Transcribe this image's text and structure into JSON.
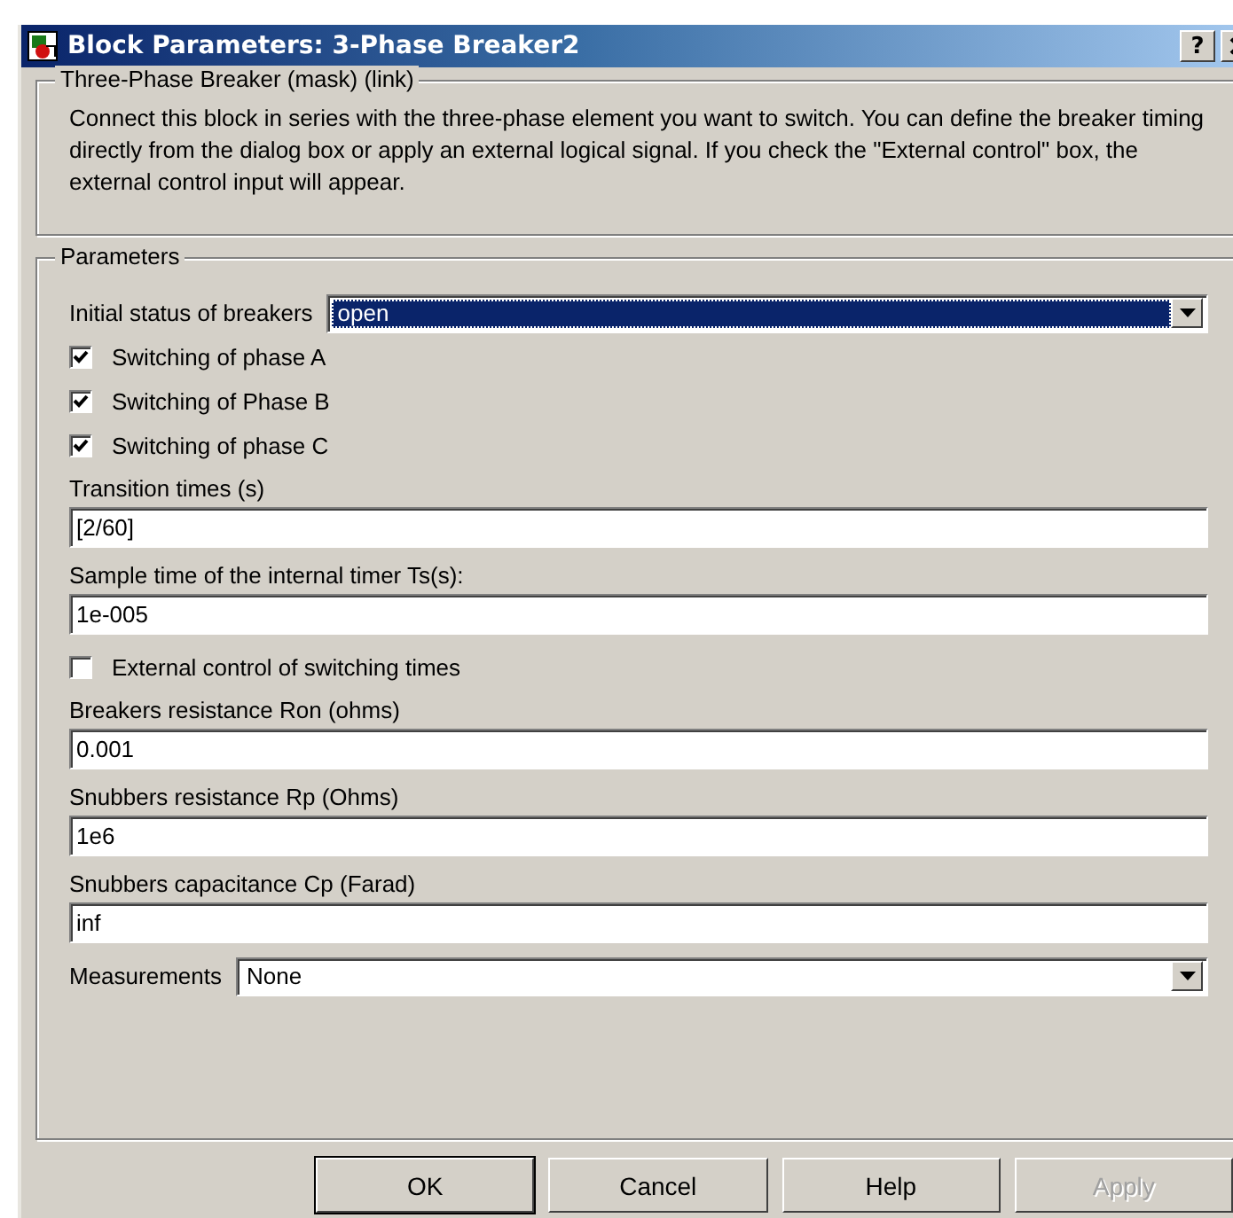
{
  "window": {
    "title": "Block Parameters: 3-Phase Breaker2",
    "help_button": "?"
  },
  "description": {
    "title": "Three-Phase Breaker (mask) (link)",
    "text": "Connect this block in series with the three-phase element you want to switch. You can define the breaker timing directly from the dialog box or apply an external logical signal. If you check  the \"External control\" box, the external control input will appear."
  },
  "parameters": {
    "title": "Parameters",
    "items": [
      {
        "kind": "dropdown",
        "label": "Initial status of breakers",
        "value": "open",
        "focused": true
      },
      {
        "kind": "checkbox",
        "label": "Switching of phase A",
        "checked": true
      },
      {
        "kind": "checkbox",
        "label": "Switching of Phase B",
        "checked": true
      },
      {
        "kind": "checkbox",
        "label": "Switching of phase C",
        "checked": true
      },
      {
        "kind": "field",
        "label": "Transition times (s)",
        "value": "[2/60]"
      },
      {
        "kind": "field",
        "label": "Sample time of the internal timer Ts(s):",
        "value": "1e-005"
      },
      {
        "kind": "checkbox",
        "label": "External control of switching times",
        "checked": false
      },
      {
        "kind": "field",
        "label": "Breakers resistance Ron (ohms)",
        "value": "0.001"
      },
      {
        "kind": "field",
        "label": "Snubbers resistance Rp (Ohms)",
        "value": "1e6"
      },
      {
        "kind": "field",
        "label": "Snubbers capacitance Cp (Farad)",
        "value": "inf"
      },
      {
        "kind": "dropdown",
        "label": "Measurements",
        "value": "None",
        "focused": false
      }
    ]
  },
  "buttons": [
    {
      "label": "OK",
      "disabled": false,
      "default": true
    },
    {
      "label": "Cancel",
      "disabled": false,
      "default": false
    },
    {
      "label": "Help",
      "disabled": false,
      "default": false
    },
    {
      "label": "Apply",
      "disabled": true,
      "default": false
    }
  ]
}
